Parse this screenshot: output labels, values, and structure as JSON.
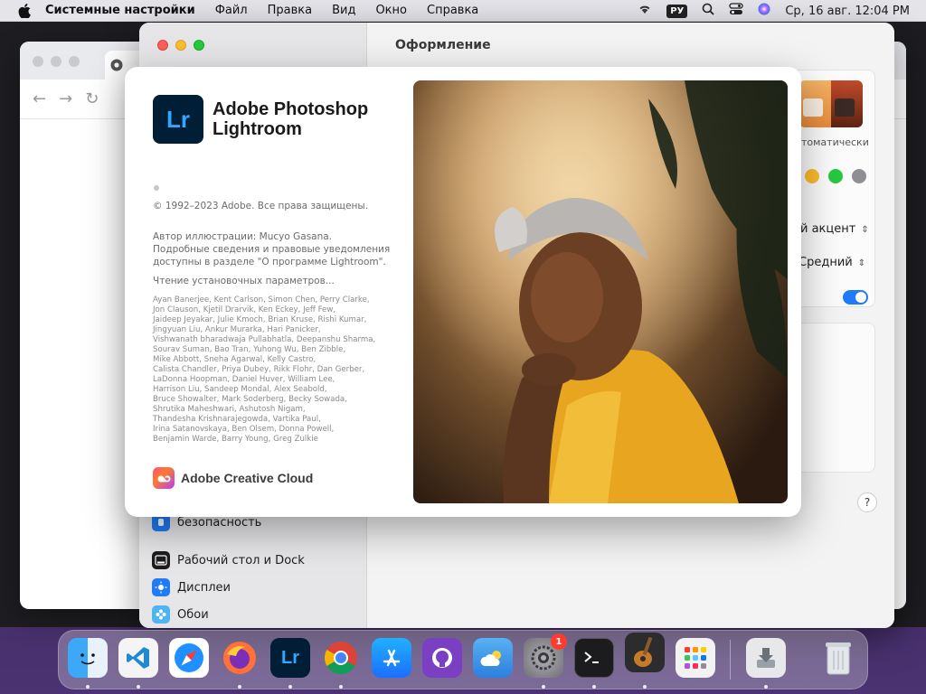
{
  "menubar": {
    "app_name": "Системные настройки",
    "items": [
      "Файл",
      "Правка",
      "Вид",
      "Окно",
      "Справка"
    ],
    "input_lang": "РУ",
    "datetime": "Ср, 16 авг.  12:04 PM"
  },
  "settings": {
    "title": "Оформление",
    "sidebar": {
      "items": [
        {
          "label": "безопасность",
          "icon": "privacy-hand-icon"
        },
        {
          "label": "Рабочий стол и Dock",
          "icon": "dock-icon"
        },
        {
          "label": "Дисплеи",
          "icon": "display-sun-icon"
        },
        {
          "label": "Обои",
          "icon": "wallpaper-flower-icon"
        }
      ]
    },
    "content": {
      "auto_label": "томатически",
      "accent_label": "й акцент",
      "size_label": "Средний",
      "accent_colors": [
        "#febc2e",
        "#28c840",
        "#8e8e93"
      ],
      "toggle_on": true,
      "help": "?"
    }
  },
  "splash": {
    "logo_text": "Lr",
    "title_line1": "Adobe Photoshop",
    "title_line2": "Lightroom",
    "copyright": "© 1992–2023 Adobe. Все права защищены.",
    "illustration": [
      "Автор иллюстрации: Mucyo Gasana.",
      "Подробные сведения и правовые уведомления",
      "доступны в разделе \"О программе Lightroom\"."
    ],
    "reading": "Чтение установочных параметров...",
    "credits": [
      "Ayan Banerjee, Kent Carlson, Simon Chen, Perry Clarke,",
      "Jon Clauson, Kjetil Drarvik, Ken Eckey, Jeff Few,",
      "Jaideep Jeyakar, Julie Kmoch, Brian Kruse, Rishi Kumar,",
      "Jingyuan Liu, Ankur Murarka, Hari Panicker,",
      "Vishwanath bharadwaja Pullabhatla, Deepanshu Sharma,",
      "Sourav Suman, Bao Tran, Yuhong Wu, Ben Zibble,",
      "Mike Abbott, Sneha Agarwal, Kelly Castro,",
      "Calista Chandler, Priya Dubey, Rikk Flohr, Dan Gerber,",
      "LaDonna Hoopman, Daniel Huver, William Lee,",
      "Harrison Liu, Sandeep Mondal, Alex Seabold,",
      "Bruce Showalter, Mark Soderberg, Becky Sowada,",
      "Shrutika Maheshwari, Ashutosh Nigam,",
      "Thandesha Krishnarajegowda, Vartika Paul,",
      "Irina Satanovskaya, Ben Olsem, Donna Powell,",
      "Benjamin Warde, Barry Young, Greg Zulkie"
    ],
    "cc_label": "Adobe Creative Cloud"
  },
  "dock": {
    "apps": [
      {
        "name": "finder",
        "color": "#3c9cf5"
      },
      {
        "name": "vscode",
        "color": "#1f8ad2"
      },
      {
        "name": "safari",
        "color": "#1e90ff"
      },
      {
        "name": "firefox",
        "color": "#ff7139"
      },
      {
        "name": "lightroom",
        "color": "#001e36",
        "label": "Lr"
      },
      {
        "name": "chrome",
        "color": "#ffffff"
      },
      {
        "name": "app-store",
        "color": "#1a8cff"
      },
      {
        "name": "github-desktop",
        "color": "#7b3fc4"
      },
      {
        "name": "weather",
        "color": "#3a8ee6"
      },
      {
        "name": "system-settings",
        "color": "#8e8e93",
        "badge": "1"
      },
      {
        "name": "terminal",
        "color": "#1c1c1e"
      },
      {
        "name": "garageband",
        "color": "#3a3a3c"
      },
      {
        "name": "launchpad",
        "color": "#f2f2f2"
      },
      {
        "name": "downloads",
        "color": "#e8e8ea"
      },
      {
        "name": "trash",
        "color": "#d9dde2"
      }
    ]
  }
}
